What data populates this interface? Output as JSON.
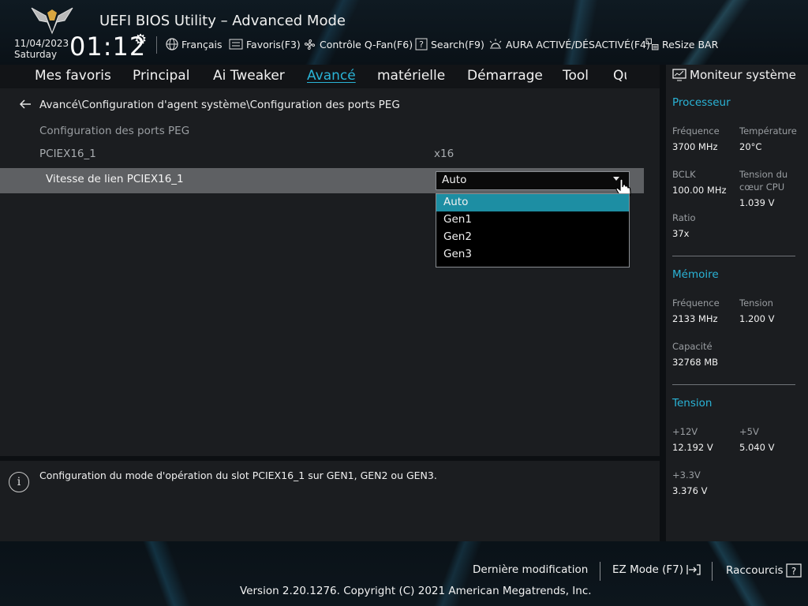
{
  "header": {
    "title": "UEFI BIOS Utility – Advanced Mode",
    "date": "11/04/2023",
    "day": "Saturday",
    "time": "01:12",
    "items": [
      {
        "label": "Français",
        "icon": "globe-icon"
      },
      {
        "label": "Favoris(F3)",
        "icon": "favorites-icon"
      },
      {
        "label": "Contrôle Q-Fan(F6)",
        "icon": "fan-icon"
      },
      {
        "label": "Search(F9)",
        "icon": "search-help-icon"
      },
      {
        "label": "AURA ACTIVÉ/DÉSACTIVÉ(F4)",
        "icon": "aura-icon"
      },
      {
        "label": "ReSize BAR",
        "icon": "resize-bar-icon"
      }
    ]
  },
  "nav": {
    "tabs": [
      "Mes favoris",
      "Principal",
      "Ai Tweaker",
      "Avancé",
      "matérielle",
      "Démarrage",
      "Tool",
      "Quitter"
    ],
    "active": "Avancé"
  },
  "main": {
    "breadcrumb": "Avancé\\Configuration d'agent système\\Configuration des ports PEG",
    "section_title": "Configuration des ports PEG",
    "info_row": {
      "label": "PCIEX16_1",
      "value": "x16"
    },
    "setting": {
      "label": "Vitesse de lien PCIEX16_1",
      "value": "Auto",
      "options": [
        "Auto",
        "Gen1",
        "Gen2",
        "Gen3"
      ],
      "highlighted": "Auto"
    }
  },
  "help": {
    "text": "Configuration du mode d'opération du slot PCIEX16_1 sur GEN1, GEN2 ou GEN3."
  },
  "monitor": {
    "title": "Moniteur système",
    "processor": {
      "heading": "Processeur",
      "freq_label": "Fréquence",
      "freq_value": "3700 MHz",
      "temp_label": "Température",
      "temp_value": "20°C",
      "bclk_label": "BCLK",
      "bclk_value": "100.00 MHz",
      "vcore_label": "Tension du cœur CPU",
      "vcore_value": "1.039 V",
      "ratio_label": "Ratio",
      "ratio_value": "37x"
    },
    "memory": {
      "heading": "Mémoire",
      "freq_label": "Fréquence",
      "freq_value": "2133 MHz",
      "volt_label": "Tension",
      "volt_value": "1.200 V",
      "cap_label": "Capacité",
      "cap_value": "32768 MB"
    },
    "voltage": {
      "heading": "Tension",
      "v12_label": "+12V",
      "v12_value": "12.192 V",
      "v5_label": "+5V",
      "v5_value": "5.040 V",
      "v33_label": "+3.3V",
      "v33_value": "3.376 V"
    }
  },
  "footer": {
    "last_modified": "Dernière modification",
    "ez_mode": "EZ Mode (F7)",
    "shortcuts": "Raccourcis",
    "version": "Version 2.20.1276. Copyright (C) 2021 American Megatrends, Inc."
  },
  "colors": {
    "accent": "#2ab3d6",
    "selection": "#1d8ea3",
    "row_highlight": "#5e6063"
  }
}
